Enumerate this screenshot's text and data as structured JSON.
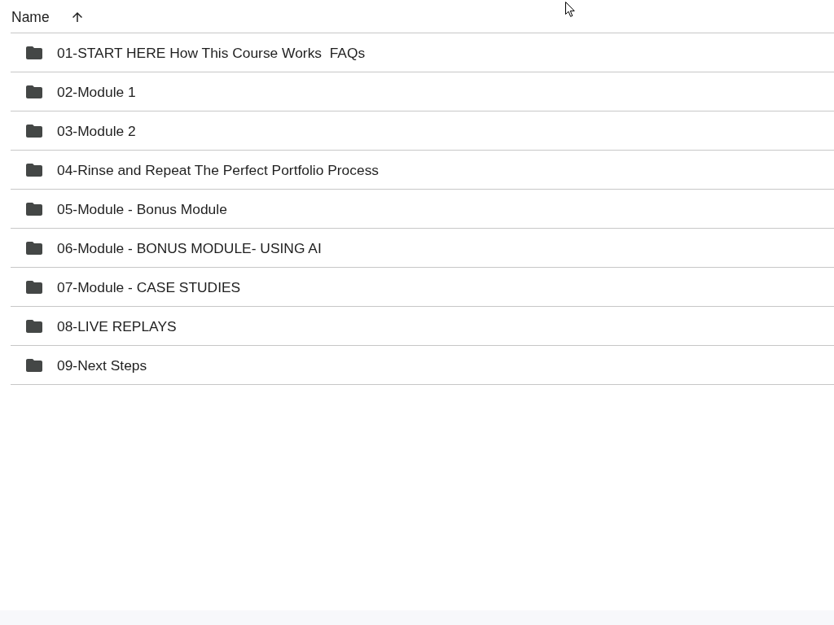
{
  "table": {
    "columns": [
      {
        "label": "Name",
        "ascending": true
      }
    ],
    "rows": [
      {
        "kind": "folder",
        "name": "01-START HERE How This Course Works  FAQs"
      },
      {
        "kind": "folder",
        "name": "02-Module 1"
      },
      {
        "kind": "folder",
        "name": "03-Module 2"
      },
      {
        "kind": "folder",
        "name": "04-Rinse and Repeat The Perfect Portfolio Process"
      },
      {
        "kind": "folder",
        "name": "05-Module - Bonus Module"
      },
      {
        "kind": "folder",
        "name": "06-Module - BONUS MODULE- USING AI"
      },
      {
        "kind": "folder",
        "name": "07-Module - CASE STUDIES"
      },
      {
        "kind": "folder",
        "name": "08-LIVE REPLAYS"
      },
      {
        "kind": "folder",
        "name": "09-Next Steps"
      }
    ]
  }
}
